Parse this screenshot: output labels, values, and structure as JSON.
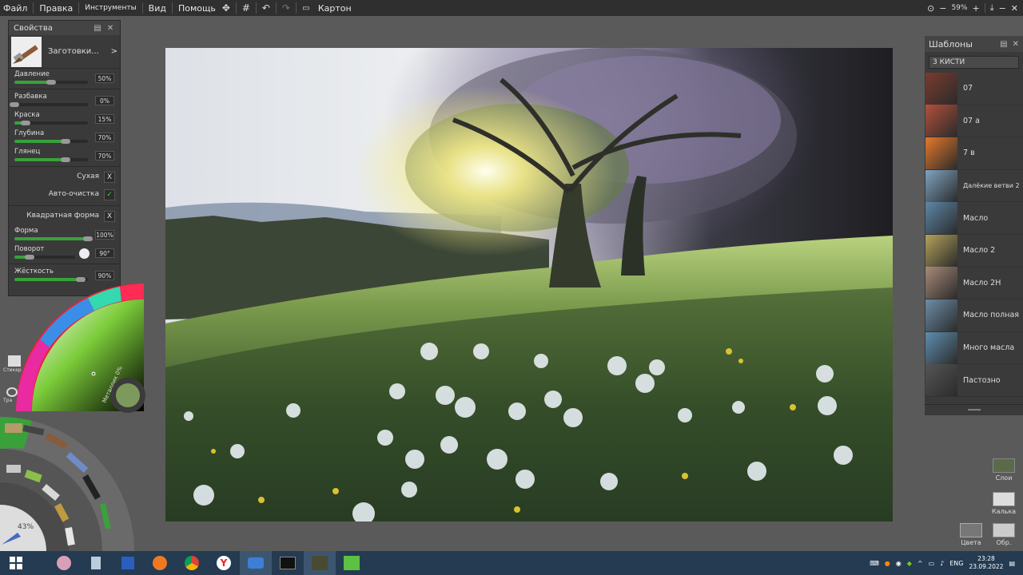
{
  "menubar": {
    "file": "Файл",
    "edit": "Правка",
    "tools": "Инструменты",
    "view": "Вид",
    "help": "Помощь",
    "document": "Картон",
    "zoom": "59%"
  },
  "props": {
    "title": "Свойства",
    "preset_name": "Заготовки...",
    "pressure": {
      "label": "Давление",
      "value": "50%",
      "level": 0.5
    },
    "thinning": {
      "label": "Разбавка",
      "value": "0%",
      "level": 0.0
    },
    "paint": {
      "label": "Краска",
      "value": "15%",
      "level": 0.15
    },
    "depth": {
      "label": "Глубина",
      "value": "70%",
      "level": 0.7
    },
    "gloss": {
      "label": "Глянец",
      "value": "70%",
      "level": 0.7
    },
    "dry": {
      "label": "Сухая",
      "mark": "X"
    },
    "autoclean": {
      "label": "Авто-очистка",
      "mark": "✓"
    },
    "square": {
      "label": "Квадратная форма",
      "mark": "X"
    },
    "shape": {
      "label": "Форма",
      "value": "100%",
      "level": 1.0
    },
    "rotation": {
      "label": "Поворот",
      "value": "90°",
      "level": 0.25
    },
    "hardness": {
      "label": "Жёсткость",
      "value": "90%",
      "level": 0.9
    }
  },
  "colorwheel": {
    "metallic_label": "Металлик 0%",
    "sticker_label": "Стикер",
    "trace_label": "Тра"
  },
  "toolrack": {
    "size_label": "43%"
  },
  "templates": {
    "title": "Шаблоны",
    "set": "3 КИСТИ",
    "items": [
      {
        "name": "07",
        "color": "#7a3b2e"
      },
      {
        "name": "07 а",
        "color": "#b4503a"
      },
      {
        "name": "7 в",
        "color": "#e6782a"
      },
      {
        "name": "Далёкие ветви 2",
        "color": "#7fa3c2"
      },
      {
        "name": "Масло",
        "color": "#5d87a8"
      },
      {
        "name": "Масло 2",
        "color": "#b4a25a"
      },
      {
        "name": "Масло 2Н",
        "color": "#a88a78"
      },
      {
        "name": "Масло полная",
        "color": "#6c8ea8"
      },
      {
        "name": "Много масла",
        "color": "#5e8eb0"
      },
      {
        "name": "Пастозно",
        "color": "#555555"
      }
    ]
  },
  "right_buttons": {
    "layers": "Слои",
    "tracing": "Калька",
    "colors": "Цвета",
    "image": "Обр."
  },
  "taskbar": {
    "lang": "ENG",
    "time": "23:28",
    "date": "23.09.2022"
  }
}
